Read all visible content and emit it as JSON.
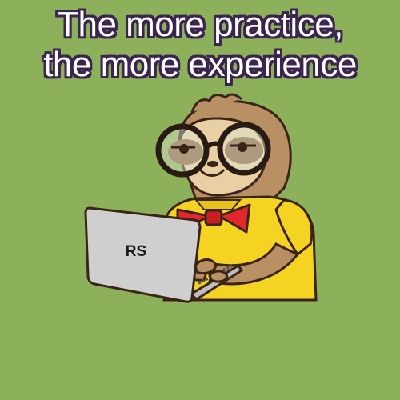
{
  "headline": {
    "line1": "The more practice,",
    "line2": "the more experience"
  },
  "laptop": {
    "logo_text": "RS"
  },
  "colors": {
    "background": "#8db15a",
    "headline_fill": "#ffffff",
    "headline_outline": "#3b2550",
    "sloth_fur": "#b98f64",
    "sloth_face": "#e8cfa4",
    "shirt": "#f5d323",
    "bow_tie": "#e3272b",
    "laptop": "#cfcfcf",
    "glasses": "#2a1a14"
  },
  "icons": [
    "sloth-character-icon",
    "glasses-icon",
    "bow-tie-icon",
    "laptop-icon"
  ]
}
